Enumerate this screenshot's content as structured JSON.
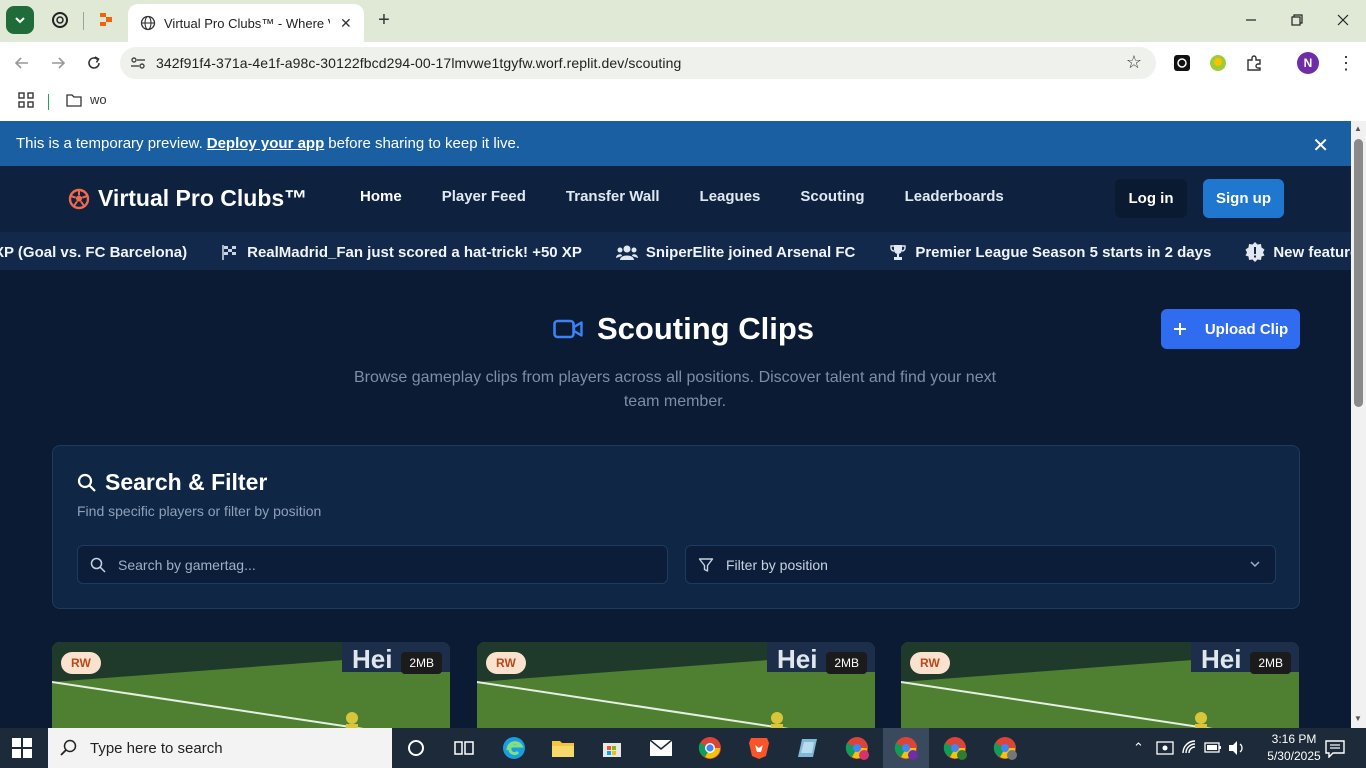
{
  "browser": {
    "tab_title": "Virtual Pro Clubs™ - Where Virt",
    "url": "342f91f4-371a-4e1f-a98c-30122fbcd294-00-17lmvwe1tgyfw.worf.replit.dev/scouting",
    "bookmark_folder": "wo",
    "profile_initial": "N"
  },
  "banner": {
    "text_before": "This is a temporary preview.",
    "link": "Deploy your app",
    "text_after": "before sharing to keep it live."
  },
  "site": {
    "brand": "Virtual Pro Clubs™",
    "nav": [
      "Home",
      "Player Feed",
      "Transfer Wall",
      "Leagues",
      "Scouting",
      "Leaderboards"
    ],
    "login": "Log in",
    "signup": "Sign up"
  },
  "ticker": [
    {
      "icon": "none",
      "text": "XP (Goal vs. FC Barcelona)"
    },
    {
      "icon": "flag-checkered-icon",
      "text": "RealMadrid_Fan just scored a hat-trick! +50 XP"
    },
    {
      "icon": "users-icon",
      "text": "SniperElite joined Arsenal FC"
    },
    {
      "icon": "trophy-icon",
      "text": "Premier League Season 5 starts in 2 days"
    },
    {
      "icon": "alert-badge-icon",
      "text": "New feature: Auto Highlight Editor now"
    }
  ],
  "scouting": {
    "title": "Scouting Clips",
    "subtitle": "Browse gameplay clips from players across all positions. Discover talent and find your next team member.",
    "upload_label": "Upload Clip"
  },
  "filter": {
    "title": "Search & Filter",
    "subtitle": "Find specific players or filter by position",
    "search_placeholder": "Search by gamertag...",
    "position_label": "Filter by position"
  },
  "clips": [
    {
      "position": "RW",
      "size": "2MB"
    },
    {
      "position": "RW",
      "size": "2MB"
    },
    {
      "position": "RW",
      "size": "2MB"
    }
  ],
  "taskbar": {
    "search_placeholder": "Type here to search",
    "time": "3:16 PM",
    "date": "5/30/2025"
  },
  "colors": {
    "page_bg": "#0b1b33",
    "nav_bg": "#0e2240",
    "banner_bg": "#1b5fa3",
    "accent_blue": "#2f6cf0",
    "logo_red": "#f26a4b",
    "badge_bg": "#fbe2cf",
    "badge_text": "#b8491b"
  }
}
